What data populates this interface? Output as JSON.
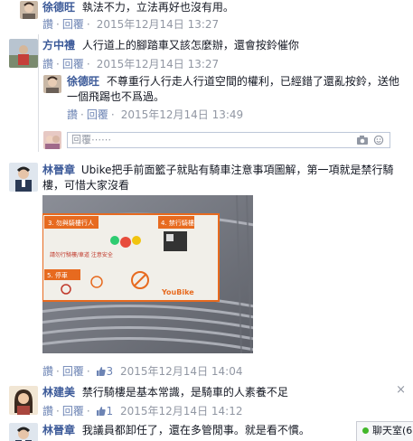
{
  "actions": {
    "reply": "回覆",
    "like": "讚",
    "sep": "·"
  },
  "comments": [
    {
      "author": "徐德旺",
      "text": "執法不力，立法再好也沒有用。",
      "time": "2015年12月14日 13:27"
    },
    {
      "author": "方中禮",
      "text": "人行道上的腳踏車又該怎麼辦，還會按鈴催你",
      "time": "2015年12月14日 13:27"
    },
    {
      "author": "徐德旺",
      "text": "不尊重行人行走人行道空間的權利，已經錯了還亂按鈴，送他一個飛踢也不爲過。",
      "time": "2015年12月14日 13:49"
    },
    {
      "author": "林晉章",
      "text": "Ubike把手前面籃子就貼有騎車注意事項圖解，第一項就是禁行騎樓，可惜大家沒看",
      "time": "2015年12月14日 14:04",
      "likes": "3"
    },
    {
      "author": "林建美",
      "text": "禁行騎樓是基本常識，是騎車的人素養不足",
      "time": "2015年12月14日 14:12",
      "likes": "1"
    },
    {
      "author": "林晉章",
      "text": "我議員都卸任了，還在多管閒事。就是看不慣。"
    }
  ],
  "reply_box": {
    "placeholder": "回覆⋯⋯"
  },
  "photo_sign": {
    "step3": "3. 勿與騎樓行人",
    "step4": "4. 禁行騎樓",
    "step5": "5. 停車",
    "text": "請勿行騎樓/車道 注意安全",
    "brand": "YouBike"
  },
  "close": "×",
  "chat": {
    "label": "聊天室(6)"
  },
  "colors": {
    "link": "#3b5998",
    "meta": "#9197a3",
    "online": "#42b72a"
  }
}
